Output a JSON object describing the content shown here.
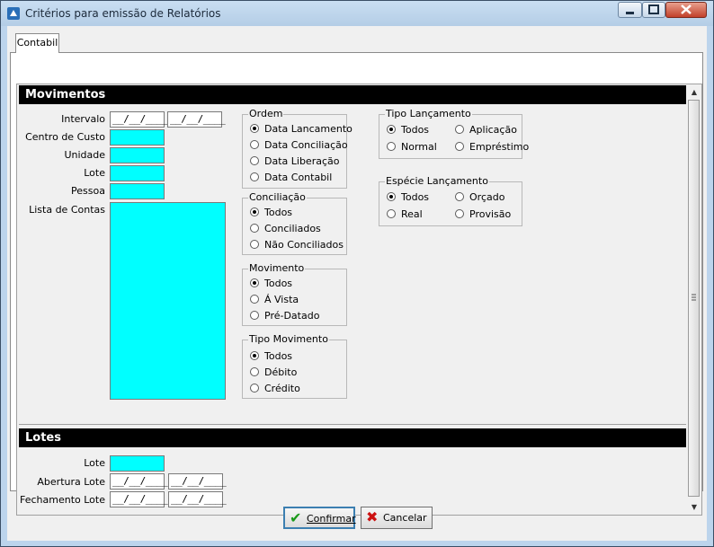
{
  "window": {
    "title": "Critérios para emissão de Relatórios"
  },
  "tab": {
    "label": "Contabil"
  },
  "movimentos": {
    "header": "Movimentos",
    "labels": {
      "intervalo": "Intervalo",
      "centro_custo": "Centro de Custo",
      "unidade": "Unidade",
      "lote": "Lote",
      "pessoa": "Pessoa",
      "lista_contas": "Lista de Contas"
    },
    "intervalo_inicio": "__/__/____",
    "intervalo_fim": "__/__/____"
  },
  "ordem": {
    "title": "Ordem",
    "options": [
      "Data Lancamento",
      "Data Conciliação",
      "Data Liberação",
      "Data Contabil"
    ],
    "selected": "Data Lancamento"
  },
  "conciliacao": {
    "title": "Conciliação",
    "options": [
      "Todos",
      "Conciliados",
      "Não Conciliados"
    ],
    "selected": "Todos"
  },
  "movimento": {
    "title": "Movimento",
    "options": [
      "Todos",
      "Á Vista",
      "Pré-Datado"
    ],
    "selected": "Todos"
  },
  "tipo_movimento": {
    "title": "Tipo Movimento",
    "options": [
      "Todos",
      "Débito",
      "Crédito"
    ],
    "selected": "Todos"
  },
  "tipo_lancamento": {
    "title": "Tipo Lançamento",
    "options": [
      "Todos",
      "Aplicação",
      "Normal",
      "Empréstimo"
    ],
    "selected": "Todos"
  },
  "especie_lancamento": {
    "title": "Espécie Lançamento",
    "options": [
      "Todos",
      "Orçado",
      "Real",
      "Provisão"
    ],
    "selected": "Todos"
  },
  "lotes": {
    "header": "Lotes",
    "labels": {
      "lote": "Lote",
      "abertura": "Abertura Lote",
      "fechamento": "Fechamento Lote"
    },
    "abertura_inicio": "__/__/____",
    "abertura_fim": "__/__/____",
    "fechamento_inicio": "__/__/____",
    "fechamento_fim": "__/__/____"
  },
  "buttons": {
    "confirmar": "Confirmar",
    "cancelar": "Cancelar"
  },
  "colors": {
    "input_bg": "#00ffff",
    "header_bg": "#000000",
    "confirm_icon": "#1a9a1a",
    "cancel_icon": "#cc1111"
  },
  "icons": [
    "app-icon",
    "minimize-icon",
    "maximize-icon",
    "close-icon",
    "check-icon",
    "x-icon",
    "scroll-up-icon",
    "scroll-down-icon"
  ]
}
